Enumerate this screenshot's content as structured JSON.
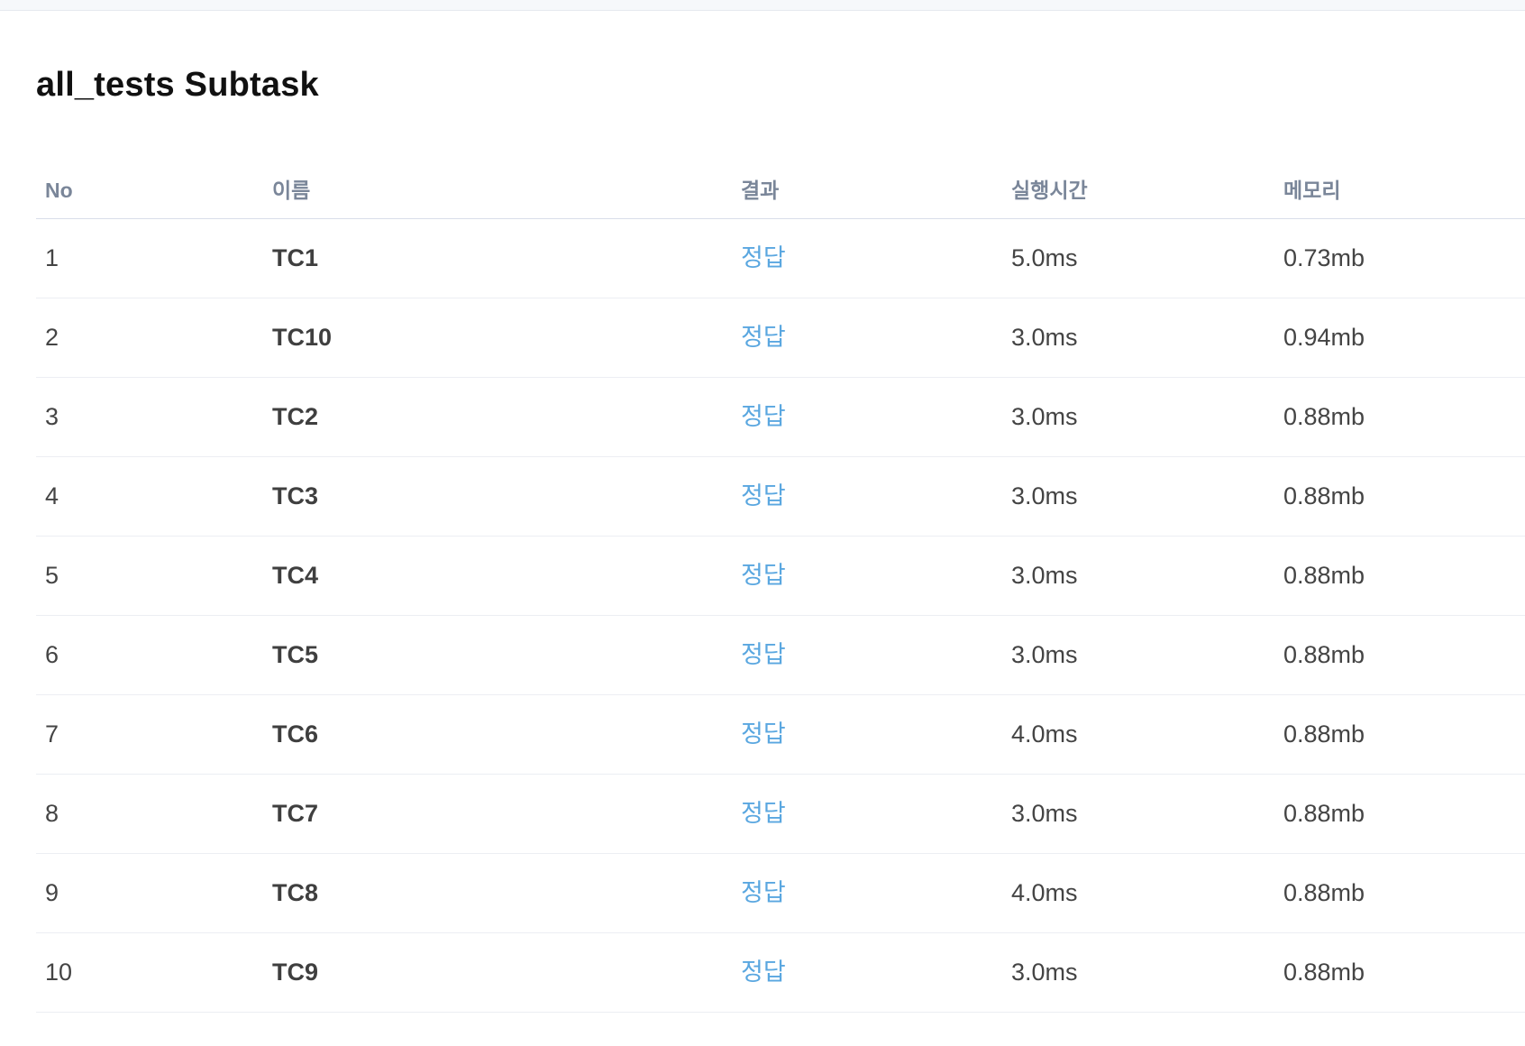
{
  "subtask": {
    "title": "all_tests Subtask"
  },
  "table": {
    "headers": {
      "no": "No",
      "name": "이름",
      "result": "결과",
      "time": "실행시간",
      "memory": "메모리"
    },
    "rows": [
      {
        "no": "1",
        "name": "TC1",
        "result": "정답",
        "time": "5.0ms",
        "memory": "0.73mb"
      },
      {
        "no": "2",
        "name": "TC10",
        "result": "정답",
        "time": "3.0ms",
        "memory": "0.94mb"
      },
      {
        "no": "3",
        "name": "TC2",
        "result": "정답",
        "time": "3.0ms",
        "memory": "0.88mb"
      },
      {
        "no": "4",
        "name": "TC3",
        "result": "정답",
        "time": "3.0ms",
        "memory": "0.88mb"
      },
      {
        "no": "5",
        "name": "TC4",
        "result": "정답",
        "time": "3.0ms",
        "memory": "0.88mb"
      },
      {
        "no": "6",
        "name": "TC5",
        "result": "정답",
        "time": "3.0ms",
        "memory": "0.88mb"
      },
      {
        "no": "7",
        "name": "TC6",
        "result": "정답",
        "time": "4.0ms",
        "memory": "0.88mb"
      },
      {
        "no": "8",
        "name": "TC7",
        "result": "정답",
        "time": "3.0ms",
        "memory": "0.88mb"
      },
      {
        "no": "9",
        "name": "TC8",
        "result": "정답",
        "time": "4.0ms",
        "memory": "0.88mb"
      },
      {
        "no": "10",
        "name": "TC9",
        "result": "정답",
        "time": "3.0ms",
        "memory": "0.88mb"
      }
    ]
  },
  "colors": {
    "accepted": "#5aa7e0",
    "header_text": "#7a8699",
    "body_text": "#444444"
  }
}
